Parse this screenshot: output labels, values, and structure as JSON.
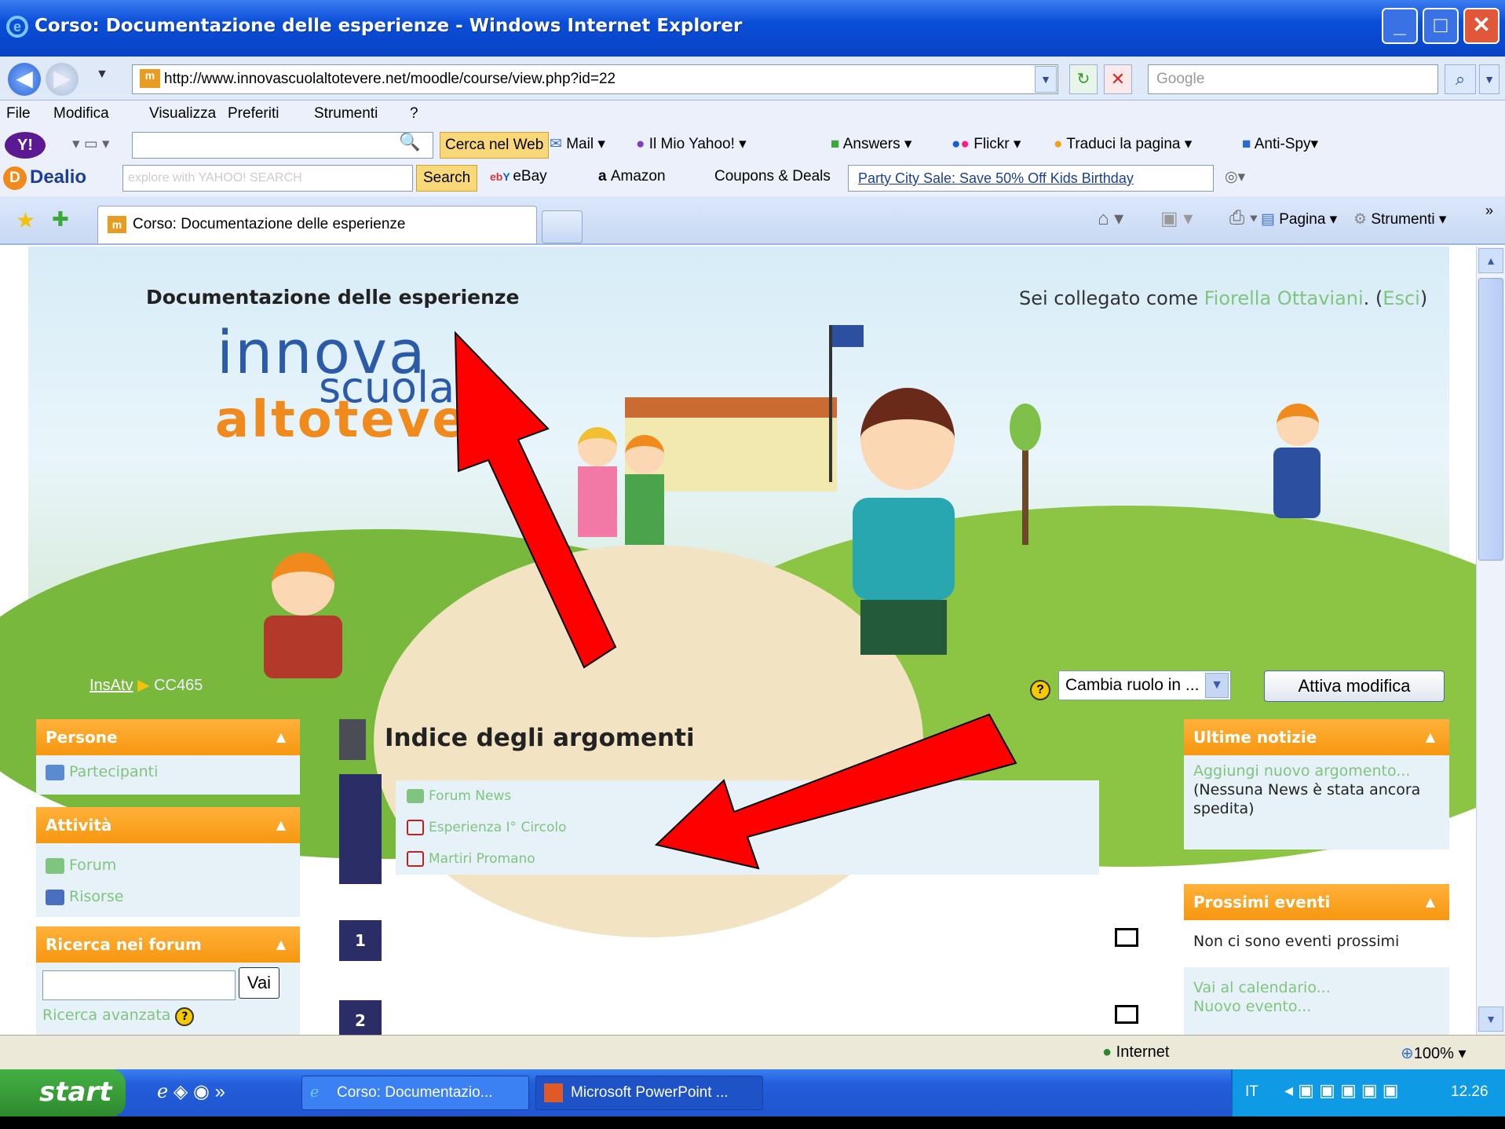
{
  "window": {
    "title": "Corso: Documentazione delle esperienze - Windows Internet Explorer"
  },
  "address_bar": {
    "url": "http://www.innovascuolaltotevere.net/moodle/course/view.php?id=22",
    "search_placeholder": "Google"
  },
  "menu": [
    "File",
    "Modifica",
    "Visualizza",
    "Preferiti",
    "Strumenti",
    "?"
  ],
  "yahoo_toolbar": {
    "search_button": "Cerca nel Web",
    "items": [
      "Mail",
      "Il Mio Yahoo!",
      "Answers",
      "Flickr",
      "Traduci la pagina",
      "Anti-Spy"
    ]
  },
  "dealio_toolbar": {
    "brand": "Dealio",
    "search_placeholder": "explore with YAHOO! SEARCH",
    "search_button": "Search",
    "items": [
      "eBay",
      "Amazon",
      "Coupons & Deals"
    ],
    "ad_link": "Party City Sale: Save 50% Off Kids Birthday"
  },
  "tab": {
    "title": "Corso: Documentazione delle esperienze"
  },
  "command_bar": {
    "page": "Pagina",
    "tools": "Strumenti"
  },
  "header": {
    "course_title": "Documentazione delle esperienze",
    "login_prefix": "Sei collegato come",
    "user": "Fiorella Ottaviani",
    "logout": "Esci",
    "logo": [
      "innova",
      "scuola",
      "altotevere"
    ],
    "breadcrumb": [
      "InsAtv",
      "CC465"
    ],
    "role_select": "Cambia ruolo in ...",
    "edit_button": "Attiva modifica"
  },
  "left_blocks": [
    {
      "title": "Persone",
      "items": [
        "Partecipanti"
      ]
    },
    {
      "title": "Attività",
      "items": [
        "Forum",
        "Risorse"
      ]
    },
    {
      "title": "Ricerca nei forum",
      "button": "Vai",
      "link": "Ricerca avanzata"
    }
  ],
  "center": {
    "heading": "Indice degli argomenti",
    "resources": [
      "Forum News",
      "Esperienza I° Circolo",
      "Martiri Promano"
    ],
    "sections": [
      "1",
      "2"
    ]
  },
  "right_blocks": {
    "news": {
      "title": "Ultime notizie",
      "add_link": "Aggiungi nuovo argomento...",
      "empty": "(Nessuna News è stata ancora spedita)"
    },
    "events": {
      "title": "Prossimi eventi",
      "empty": "Non ci sono eventi prossimi",
      "calendar_link": "Vai al calendario...",
      "new_event": "Nuovo evento..."
    }
  },
  "statusbar": {
    "zone": "Internet",
    "zoom": "100%"
  },
  "taskbar": {
    "start": "start",
    "tasks": [
      "Corso: Documentazio...",
      "Microsoft PowerPoint ..."
    ],
    "lang": "IT",
    "time": "12.26"
  },
  "colors": {
    "accent_orange": "#f79710",
    "link_green": "#7fc47f",
    "section_navy": "#2b2e66",
    "arrow_red": "#ff0000"
  }
}
